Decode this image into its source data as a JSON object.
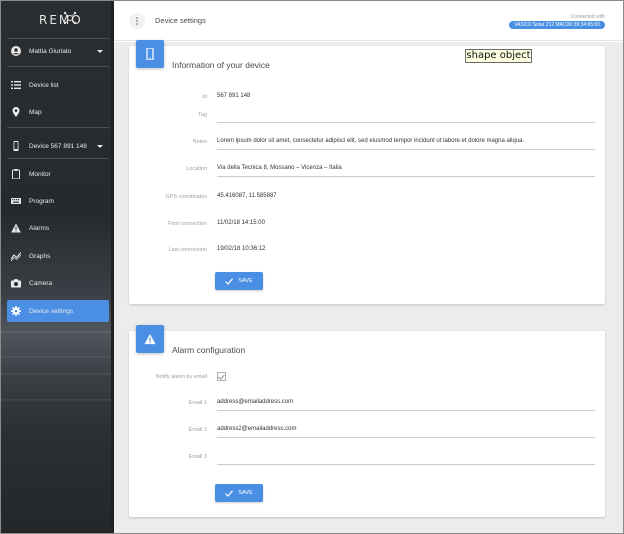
{
  "brand": {
    "logo": "REMO"
  },
  "sidebar": {
    "user": "Mattia Giuriato",
    "items": [
      {
        "label": "Device list",
        "icon": "list-icon"
      },
      {
        "label": "Map",
        "icon": "map-pin-icon"
      }
    ],
    "device": "Device 567 891 148",
    "device_items": [
      {
        "label": "Monitor",
        "icon": "clipboard-icon"
      },
      {
        "label": "Program",
        "icon": "keyboard-icon"
      },
      {
        "label": "Alarms",
        "icon": "warning-icon"
      },
      {
        "label": "Graphs",
        "icon": "graph-icon"
      },
      {
        "label": "Camera",
        "icon": "camera-icon"
      },
      {
        "label": "Device settings",
        "icon": "gear-icon",
        "active": true
      }
    ],
    "accent": "#4a8fe4"
  },
  "header": {
    "title": "Device settings",
    "connected_label": "Connected with",
    "connected_device": "VASCO Solar 212  MAC00:39:34:65:00"
  },
  "info_card": {
    "title": "Information of your device",
    "fields": [
      {
        "label": "Id",
        "value": "567 891 148"
      },
      {
        "label": "Tag",
        "value": ""
      },
      {
        "label": "Notes",
        "value": "Lorem ipsum dolor sit amet, consectetur adipisci elit, sed eiusmod tempor incidunt ut labore et dolore magna aliqua."
      },
      {
        "label": "Location",
        "value": "Via della Tecnica 8, Mossano – Vicenza – Italia"
      },
      {
        "label": "GPS coordinates",
        "value": "45.416087, 11.585887"
      },
      {
        "label": "First connection",
        "value": "11/02/18  14:15:00"
      },
      {
        "label": "Last connection",
        "value": "19/02/18  10:36:12"
      }
    ],
    "save_label": "SAVE"
  },
  "alarm_card": {
    "title": "Alarm configuration",
    "notify_label": "Notify alarm by email",
    "notify_checked": true,
    "fields": [
      {
        "label": "Email 1",
        "value": "address@emailaddress.com"
      },
      {
        "label": "Email 2",
        "value": "address2@emailaddress.com"
      },
      {
        "label": "Email 3",
        "value": ""
      }
    ],
    "save_label": "SAVE"
  },
  "overlay": {
    "text": "shape object"
  }
}
